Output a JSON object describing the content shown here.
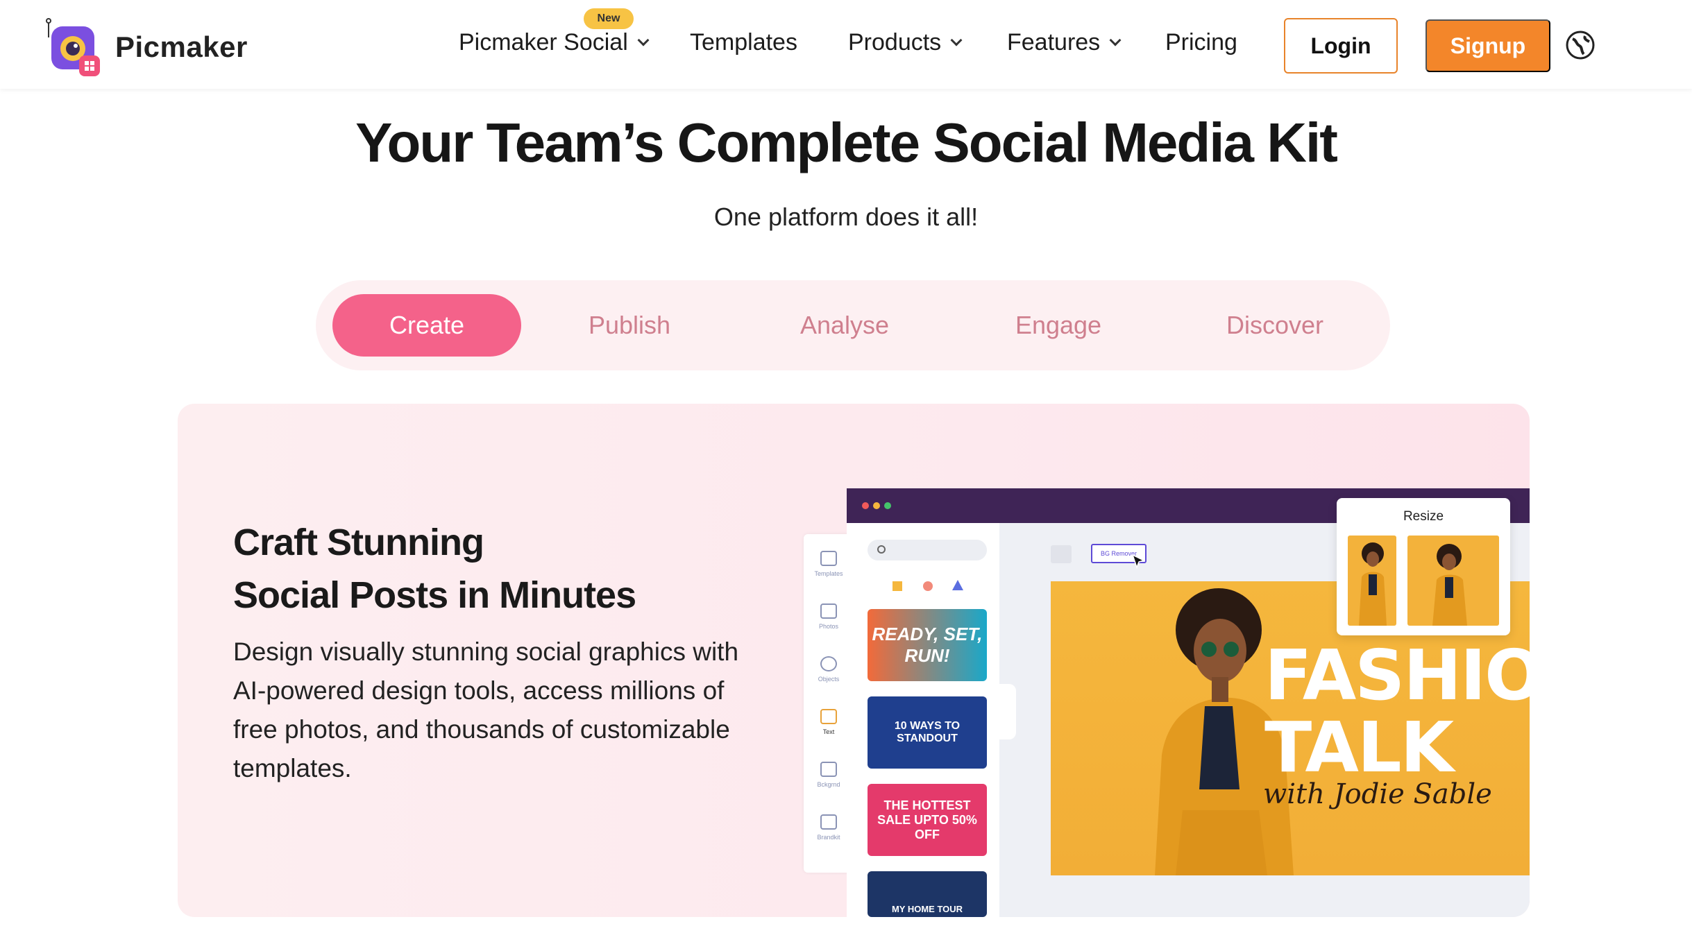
{
  "brand": {
    "name": "Picmaker",
    "accent": "#f3862a",
    "pink": "#f4628a",
    "purple": "#3f2456"
  },
  "nav": {
    "items": [
      {
        "label": "Picmaker Social",
        "dropdown": true,
        "badge": "New"
      },
      {
        "label": "Templates",
        "dropdown": false
      },
      {
        "label": "Products",
        "dropdown": true
      },
      {
        "label": "Features",
        "dropdown": true
      },
      {
        "label": "Pricing",
        "dropdown": false
      }
    ],
    "login_label": "Login",
    "signup_label": "Signup",
    "language_icon": "globe-icon"
  },
  "hero": {
    "title": "Your Team’s Complete Social Media Kit",
    "subtitle": "One platform does it all!"
  },
  "tabs": [
    {
      "label": "Create",
      "active": true
    },
    {
      "label": "Publish",
      "active": false
    },
    {
      "label": "Analyse",
      "active": false
    },
    {
      "label": "Engage",
      "active": false
    },
    {
      "label": "Discover",
      "active": false
    }
  ],
  "feature": {
    "title_line1": "Craft Stunning",
    "title_line2": "Social Posts in Minutes",
    "description": "Design visually stunning social graphics with AI-powered design tools, access millions of free photos, and thousands of customizable templates."
  },
  "mockup": {
    "sidebar": [
      "Templates",
      "Photos",
      "Objects",
      "Text",
      "Bckgrnd",
      "Brandkit"
    ],
    "active_sidebar": "Text",
    "thumbnails": [
      {
        "text": "READY, SET, RUN!",
        "bg": "#1aa8c9"
      },
      {
        "text": "10 WAYS TO STANDOUT",
        "bg": "#1f3f8e"
      },
      {
        "text": "THE HOTTEST SALE UPTO 50% OFF",
        "bg": "#e43a6b"
      },
      {
        "text": "MY HOME TOUR",
        "bg": "#1d3566"
      }
    ],
    "bg_remover_label": "BG Remover",
    "canvas_heading_1": "FASHION",
    "canvas_heading_2": "TALK",
    "canvas_signature": "with Jodie Sable",
    "resize_label": "Resize"
  }
}
